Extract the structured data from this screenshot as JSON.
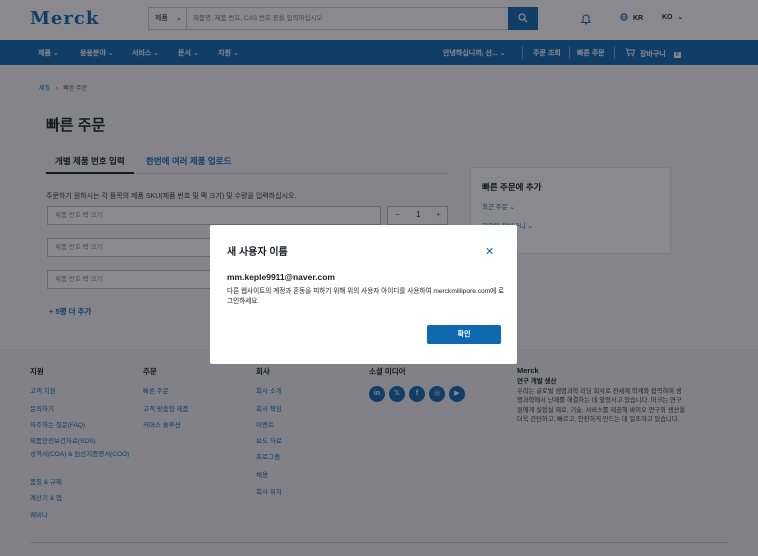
{
  "header": {
    "logo": "Merck",
    "search": {
      "category": "제품",
      "placeholder": "제품명, 제품 번호, CAS 번호 등을 입력하십시오"
    },
    "language": "KR",
    "region": "KO"
  },
  "nav": {
    "items": [
      "제품",
      "응용분야",
      "서비스",
      "문서",
      "지원"
    ],
    "greeting": "안녕하십니까, 선...",
    "order_status": "주문 조회",
    "quick_order": "빠른 주문",
    "cart": "장바구니",
    "cart_count": "0"
  },
  "breadcrumb": {
    "home": "제정",
    "current": "빠른 주문"
  },
  "page": {
    "title": "빠른 주문",
    "tabs": [
      "개별 제품 번호 입력",
      "한번에 여러 제품 업로드"
    ],
    "instructions": "주문하기 원하시는 각 품목의 제품 SKU(제품 번호 및 팩 크기) 및 수량을 입력하십시오.",
    "input_placeholder": "제품 번호 팩 크기",
    "quantity": "1",
    "add_rows": "+ 5행 더 추가"
  },
  "side_panel": {
    "title": "빠른 주문에 추가",
    "links": [
      "최근 주문",
      "저장된 장바구니"
    ]
  },
  "footer": {
    "support": {
      "title": "지원",
      "links": [
        "고객 지원",
        "문의하기",
        "자주하는 질문(FAQ)",
        "제품안전보건자료(SDS)",
        "성적서(COA) & 원산지증명서(COO)",
        "품질 & 규제",
        "계산기 & 앱",
        "웨비나"
      ]
    },
    "order": {
      "title": "주문",
      "links": [
        "빠른 주문",
        "고객 맞춤형 제품",
        "커머스 솔루션"
      ]
    },
    "company": {
      "title": "회사",
      "links": [
        "회사 소개",
        "회사 책임",
        "이벤트",
        "보도 자료",
        "프로그램",
        "채용",
        "회사 위치"
      ]
    },
    "social": {
      "title": "소셜 미디어",
      "icons": [
        "linkedin-icon",
        "x-icon",
        "facebook-icon",
        "instagram-icon",
        "youtube-icon"
      ]
    },
    "about": {
      "title": "Merck",
      "subtitle": "연구 개발 생산",
      "text": "우리는 글로벌 생명과학 리딩 회사로 전세계 학계와 협력하며 생명과학에서 난제를 해결하는 데 앞장서고 있습니다. 머크는 연구원에게 실험실 재료, 기술, 서비스를 제공해 바이오 연구와 생산을 더욱 간단하고, 빠르고, 안전하게 만드는 데 일조하고 있습니다."
    }
  },
  "modal": {
    "title": "새 사용자 이름",
    "email": "mm.keple9911@naver.com",
    "message": "다른 웹사이트의 계정과 혼동을 피하기 위해 위의 사용자 아이디를 사용하여 merckmillipore.com에 로그인하세요.",
    "confirm": "확인"
  },
  "colors": {
    "brand": "#0f69af",
    "overlay": "rgba(20,20,30,0.5)"
  }
}
